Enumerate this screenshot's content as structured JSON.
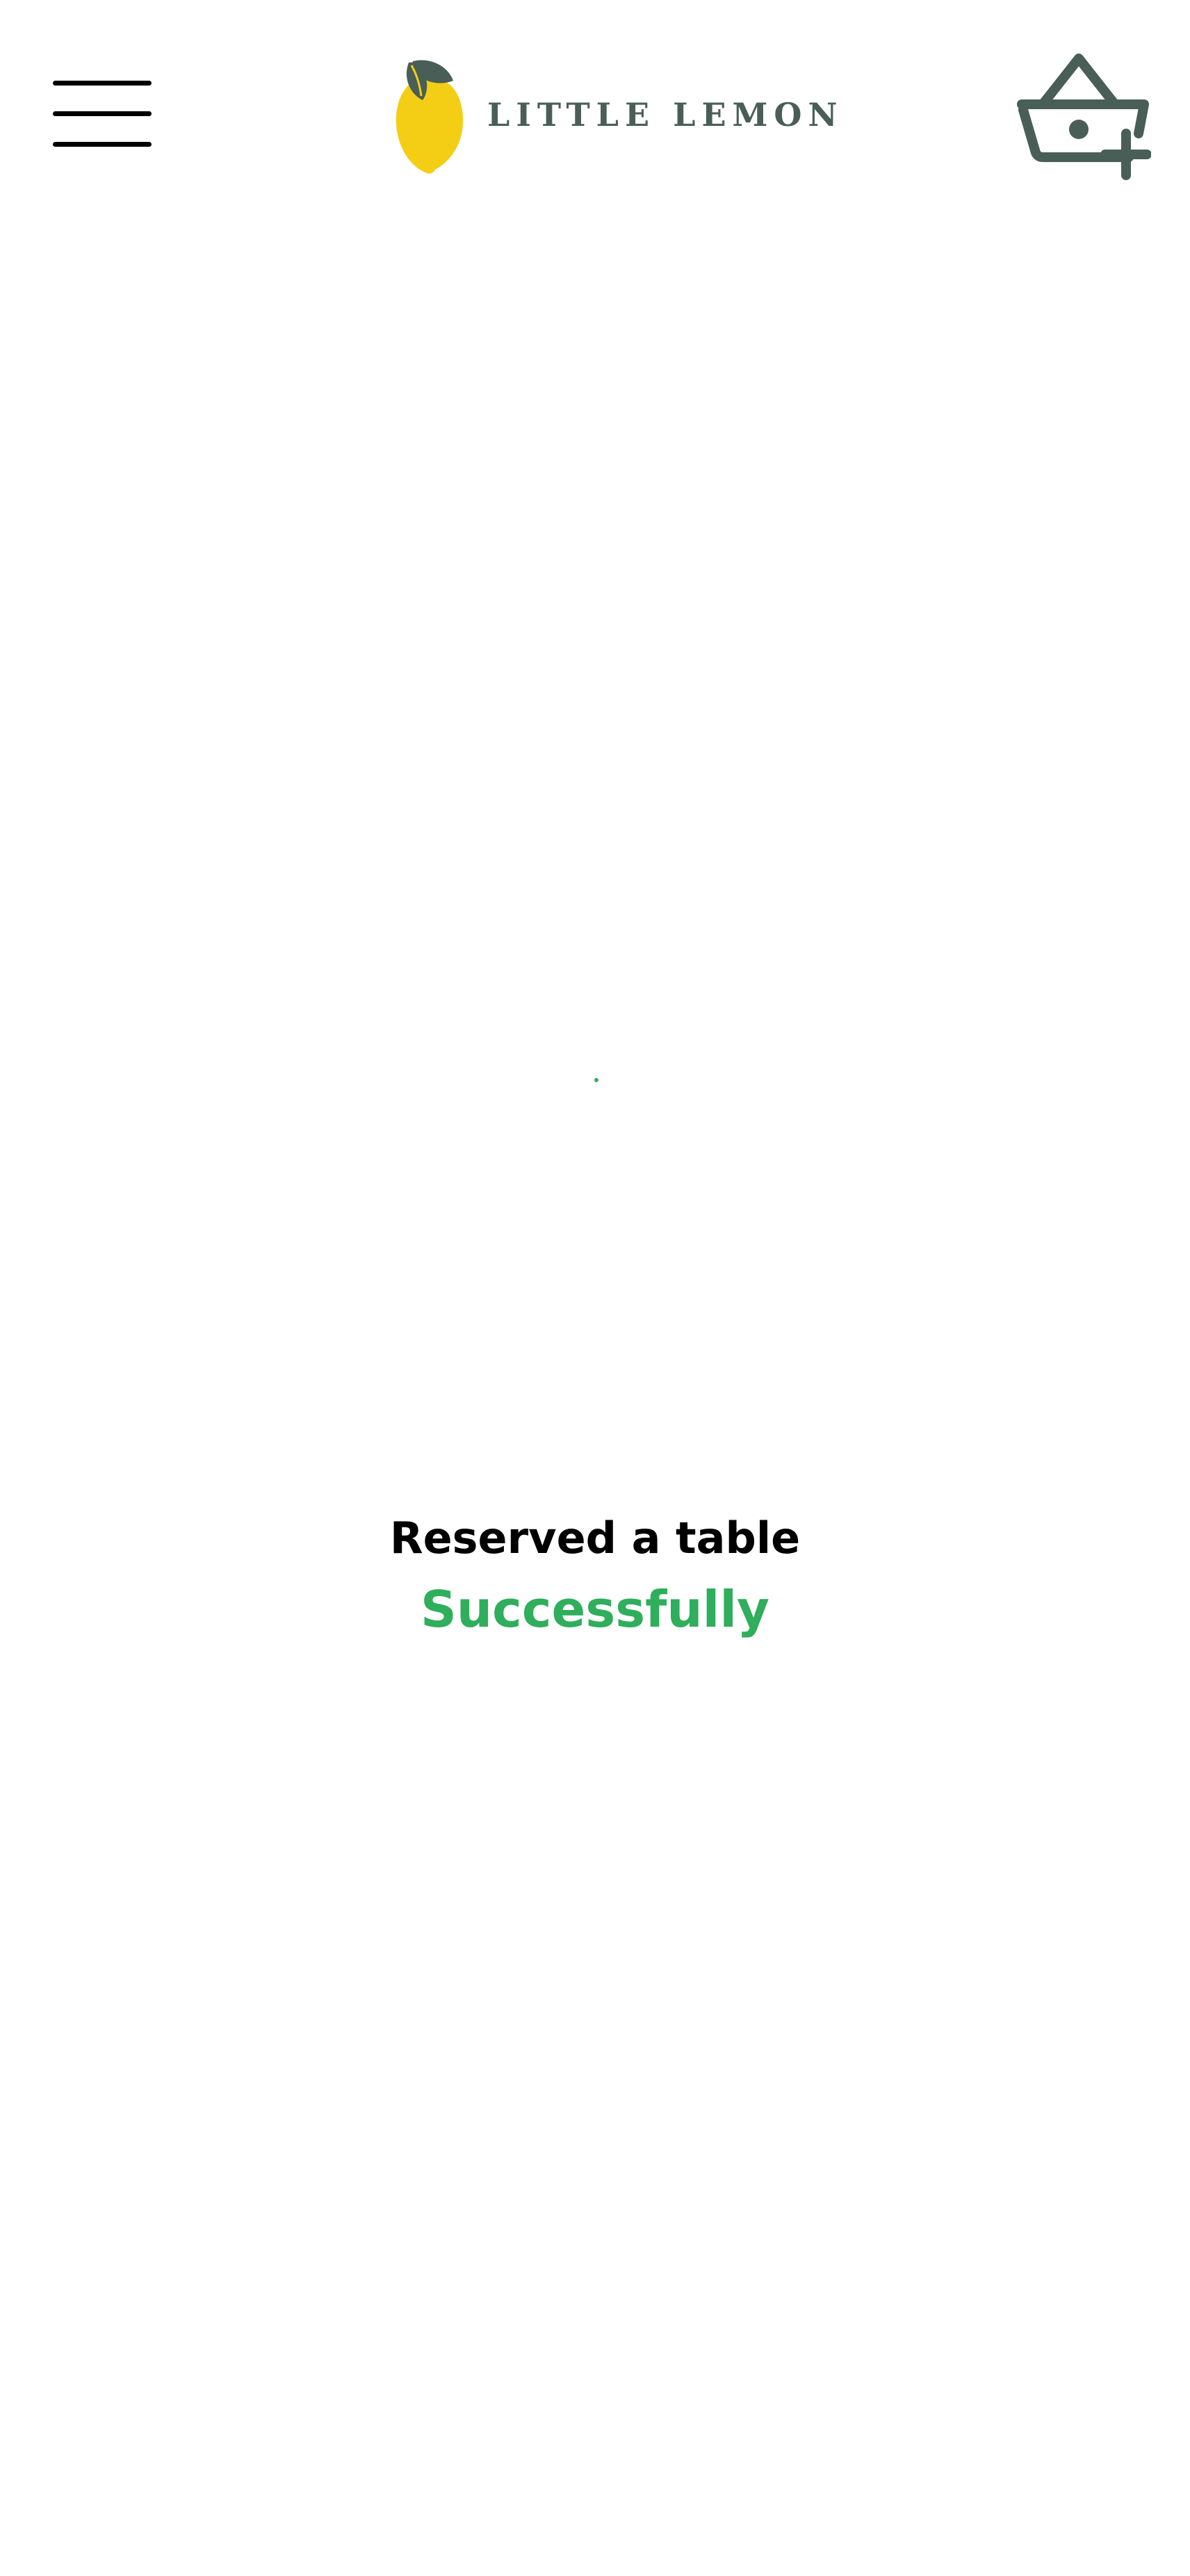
{
  "header": {
    "menu_icon": "hamburger-menu-icon",
    "logo_icon": "lemon-icon",
    "brand_name": "LITTLE LEMON",
    "cart_icon": "basket-add-icon"
  },
  "confirmation": {
    "title": "Reserved a table",
    "status": "Successfully"
  },
  "colors": {
    "brand_green": "#495e57",
    "brand_yellow": "#f4ce14",
    "success_green": "#2fae5c",
    "text_black": "#000000"
  }
}
